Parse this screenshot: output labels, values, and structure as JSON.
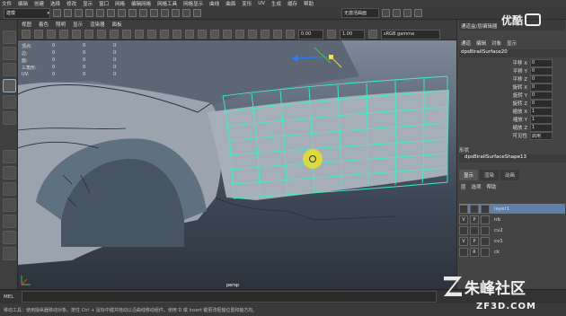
{
  "menubar": [
    "文件",
    "编辑",
    "创建",
    "选择",
    "修改",
    "显示",
    "窗口",
    "网格",
    "编辑网格",
    "网格工具",
    "网格显示",
    "曲线",
    "曲面",
    "变形",
    "UV",
    "生成",
    "缓存",
    "帮助"
  ],
  "shelf": {
    "mode": "建模",
    "workspace": "无激活曲面",
    "right_label": "通道盒/层编辑器"
  },
  "panel_menu": [
    "视图",
    "着色",
    "照明",
    "显示",
    "渲染器",
    "面板"
  ],
  "viewbar": {
    "value1": "0.00",
    "value2": "1.00",
    "colorspace": "sRGB gamma"
  },
  "hud": [
    {
      "label": "顶点:",
      "v1": "0",
      "v2": "0",
      "v3": "0"
    },
    {
      "label": "边:",
      "v1": "0",
      "v2": "0",
      "v3": "0"
    },
    {
      "label": "面:",
      "v1": "0",
      "v2": "0",
      "v3": "0"
    },
    {
      "label": "三角形:",
      "v1": "0",
      "v2": "0",
      "v3": "0"
    },
    {
      "label": "UV:",
      "v1": "0",
      "v2": "0",
      "v3": "0"
    }
  ],
  "viewport": {
    "camera": "persp"
  },
  "channel_box": {
    "menu": [
      "通道",
      "编辑",
      "对象",
      "显示"
    ],
    "node": "dpsBirailSurface20",
    "attributes": [
      {
        "name": "平移 X",
        "value": "0"
      },
      {
        "name": "平移 Y",
        "value": "0"
      },
      {
        "name": "平移 Z",
        "value": "0"
      },
      {
        "name": "旋转 X",
        "value": "0"
      },
      {
        "name": "旋转 Y",
        "value": "0"
      },
      {
        "name": "旋转 Z",
        "value": "0"
      },
      {
        "name": "缩放 X",
        "value": "1"
      },
      {
        "name": "缩放 Y",
        "value": "1"
      },
      {
        "name": "缩放 Z",
        "value": "1"
      },
      {
        "name": "可见性",
        "value": "启用"
      }
    ],
    "shape_header": "形状",
    "shape": "dpsBirailSurfaceShape13"
  },
  "layer_editor": {
    "tabs": [
      "显示",
      "渲染",
      "动画"
    ],
    "menu": [
      "层",
      "选项",
      "帮助"
    ],
    "layers": [
      {
        "v": "",
        "p": "",
        "name": "layer1"
      },
      {
        "v": "V",
        "p": "P",
        "name": "nb"
      },
      {
        "v": "",
        "p": "",
        "name": "cv2"
      },
      {
        "v": "V",
        "p": "P",
        "name": "cv1"
      },
      {
        "v": "",
        "p": "R",
        "name": "ck"
      }
    ]
  },
  "mel": {
    "label": "MEL"
  },
  "help_line": "移动工具：使用操纵器移动对象。按住 Ctrl + 鼠标中键并拖动以沿曲线移动组件。使用 D 或 Insert 键更改枢轴位置和轴方向。",
  "watermark": {
    "name": "朱峰社区",
    "url": "ZF3D.COM"
  },
  "top_logo": "优酷"
}
